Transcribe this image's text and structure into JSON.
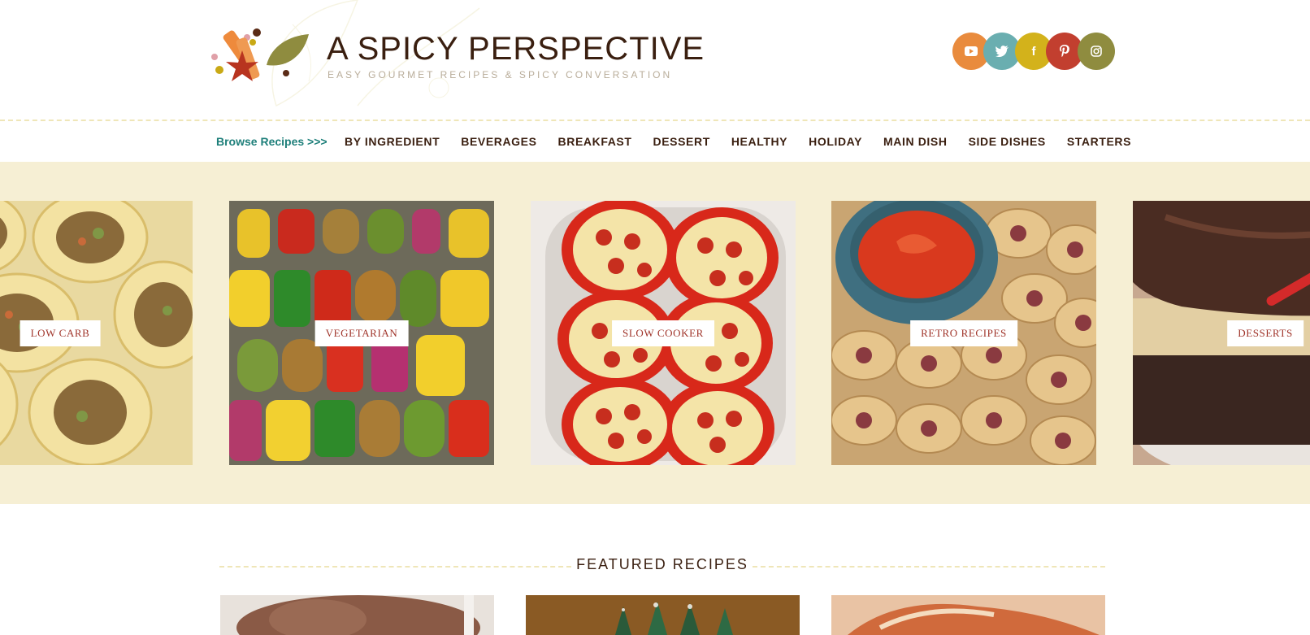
{
  "header": {
    "site_title": "A SPICY PERSPECTIVE",
    "tagline": "EASY GOURMET RECIPES & SPICY CONVERSATION"
  },
  "social": [
    {
      "name": "youtube-icon",
      "glyph": "▶",
      "color": "#e98b3d"
    },
    {
      "name": "twitter-icon",
      "glyph": "🐦",
      "color": "#6aaeb0"
    },
    {
      "name": "facebook-icon",
      "glyph": "f",
      "color": "#d3b21b"
    },
    {
      "name": "pinterest-icon",
      "glyph": "p",
      "color": "#c23f2f"
    },
    {
      "name": "instagram-icon",
      "glyph": "◎",
      "color": "#8f8c3f"
    }
  ],
  "nav": {
    "browse_label": "Browse Recipes >>>",
    "items": [
      "BY INGREDIENT",
      "BEVERAGES",
      "BREAKFAST",
      "DESSERT",
      "HEALTHY",
      "HOLIDAY",
      "MAIN DISH",
      "SIDE DISHES",
      "STARTERS"
    ]
  },
  "carousel": {
    "slides": [
      {
        "label": "LOW CARB"
      },
      {
        "label": "VEGETARIAN"
      },
      {
        "label": "SLOW COOKER"
      },
      {
        "label": "RETRO RECIPES"
      },
      {
        "label": "DESSERTS"
      }
    ]
  },
  "featured": {
    "title": "FEATURED RECIPES"
  },
  "colors": {
    "accent_teal": "#1e7f7a",
    "carousel_bg": "#f6efd4",
    "label_red": "#a0342a",
    "text_brown": "#3a1f10"
  }
}
